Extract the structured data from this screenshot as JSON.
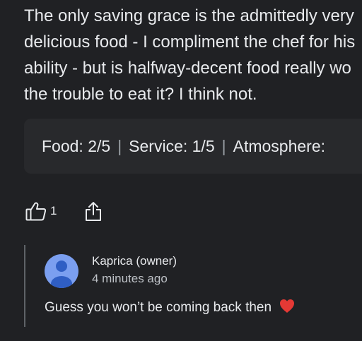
{
  "review": {
    "text": "The only saving grace is the admittedly very\ndelicious food - I compliment the chef for his\nability - but is halfway-decent food really wo\nthe trouble to eat it? I think not."
  },
  "ratings": {
    "food": "Food: 2/5",
    "service": "Service: 1/5",
    "atmosphere": "Atmosphere:",
    "separator": "|"
  },
  "actions": {
    "like_icon": "thumbs-up-icon",
    "like_count": "1",
    "share_icon": "share-icon"
  },
  "reply": {
    "avatar_icon": "person-avatar-icon",
    "owner_name": "Kaprica (owner)",
    "time": "4 minutes ago",
    "text": "Guess you won’t be coming back then",
    "emoji_icon": "red-heart-icon"
  },
  "colors": {
    "background": "#202124",
    "ratings_background": "#28292c",
    "avatar_background": "#7b9ff0",
    "heart": "#e53935"
  }
}
